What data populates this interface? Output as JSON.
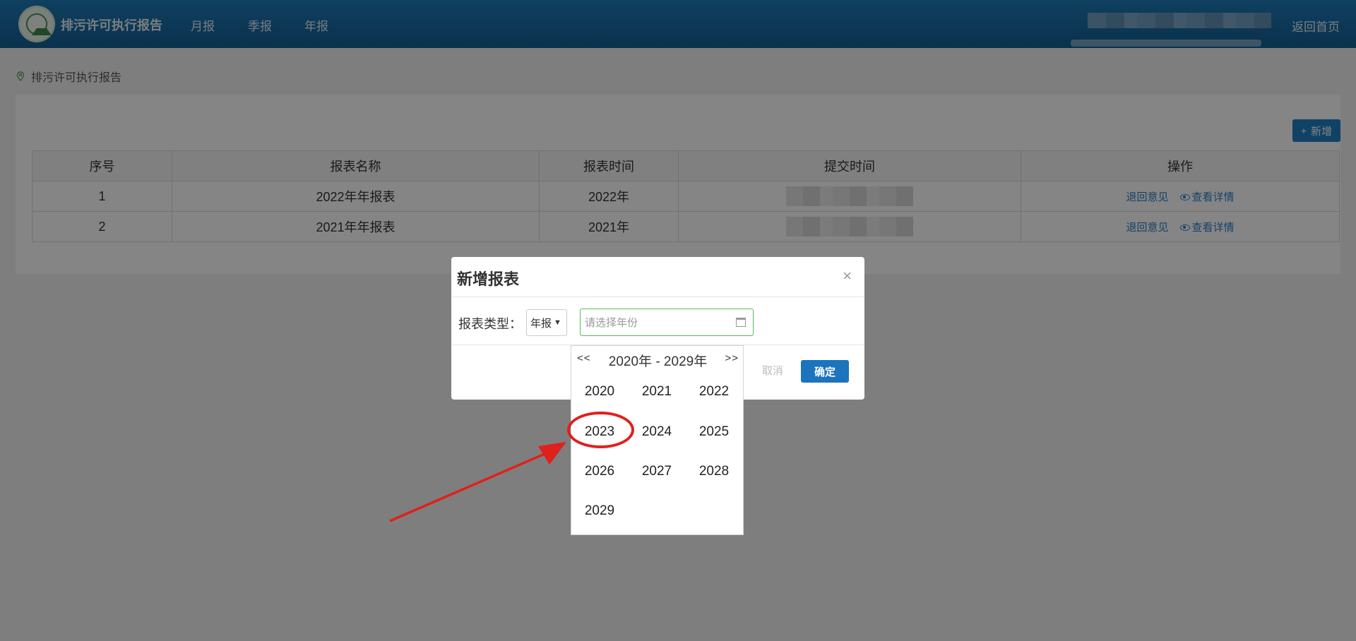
{
  "header": {
    "app_title": "排污许可执行报告",
    "nav": [
      "月报",
      "季报",
      "年报"
    ],
    "home_link": "返回首页"
  },
  "breadcrumb": {
    "text": "排污许可执行报告"
  },
  "toolbar": {
    "add_label": "新增"
  },
  "table": {
    "columns": [
      "序号",
      "报表名称",
      "报表时间",
      "提交时间",
      "操作"
    ],
    "rows": [
      {
        "index": "1",
        "name": "2022年年报表",
        "period": "2022年",
        "return_label": "退回意见",
        "detail_label": "查看详情"
      },
      {
        "index": "2",
        "name": "2021年年报表",
        "period": "2021年",
        "return_label": "退回意见",
        "detail_label": "查看详情"
      }
    ]
  },
  "modal": {
    "title": "新增报表",
    "close": "×",
    "type_label": "报表类型：",
    "type_value": "年报",
    "year_placeholder": "请选择年份",
    "cancel_label": "取消",
    "ok_label": "确定"
  },
  "picker": {
    "prev": "<<",
    "next": ">>",
    "range": "2020年 - 2029年",
    "years": [
      "2020",
      "2021",
      "2022",
      "2023",
      "2024",
      "2025",
      "2026",
      "2027",
      "2028",
      "2029"
    ],
    "highlighted": "2023"
  },
  "colors": {
    "header": "#1e7bb8",
    "accent": "#1f7fc4",
    "annotation": "#e0201c"
  }
}
